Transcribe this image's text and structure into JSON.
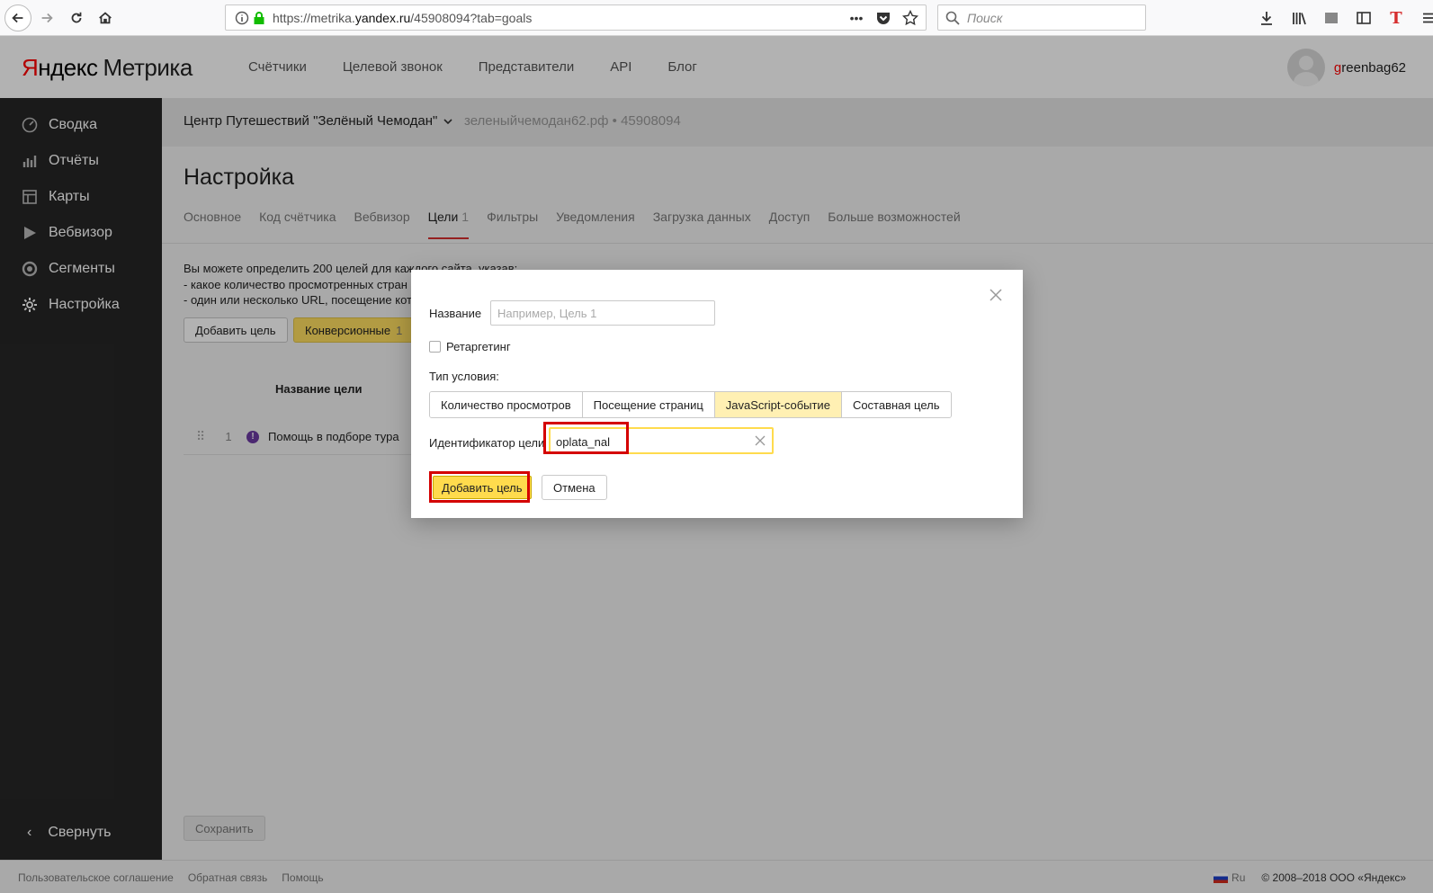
{
  "browser": {
    "url_prefix": "https://metrika.",
    "url_host": "yandex.ru",
    "url_rest": "/45908094?tab=goals",
    "search_placeholder": "Поиск",
    "more_label": "•••"
  },
  "header": {
    "logo_ya": "Я",
    "logo_ndex": "ндекс",
    "logo_product": "Метрика",
    "nav": [
      "Счётчики",
      "Целевой звонок",
      "Представители",
      "API",
      "Блог"
    ],
    "user_first": "g",
    "user_rest": "reenbag62"
  },
  "sidebar": {
    "items": [
      {
        "label": "Сводка",
        "icon": "gauge-icon"
      },
      {
        "label": "Отчёты",
        "icon": "bar-chart-icon"
      },
      {
        "label": "Карты",
        "icon": "map-grid-icon"
      },
      {
        "label": "Вебвизор",
        "icon": "play-icon"
      },
      {
        "label": "Сегменты",
        "icon": "pie-icon"
      },
      {
        "label": "Настройка",
        "icon": "gear-icon"
      }
    ],
    "collapse_label": "Свернуть",
    "collapse_glyph": "‹"
  },
  "counter": {
    "name": "Центр Путешествий \"Зелёный Чемодан\"",
    "meta": "зеленыйчемодан62.рф • 45908094"
  },
  "page": {
    "title": "Настройка",
    "tabs": [
      {
        "label": "Основное"
      },
      {
        "label": "Код счётчика"
      },
      {
        "label": "Вебвизор"
      },
      {
        "label": "Цели",
        "count": "1"
      },
      {
        "label": "Фильтры"
      },
      {
        "label": "Уведомления"
      },
      {
        "label": "Загрузка данных"
      },
      {
        "label": "Доступ"
      },
      {
        "label": "Больше возможностей"
      }
    ],
    "intro_line1": "Вы можете определить 200 целей для каждого сайта, указав:",
    "intro_line2": "-  какое количество просмотренных стран",
    "intro_line3": "-  один или несколько URL, посещение кот",
    "add_goal_label": "Добавить цель",
    "conversion_label": "Конверсионные",
    "conversion_count": "1",
    "goal_col_header": "Название цели",
    "goals": [
      {
        "num": "1",
        "name": "Помощь в подборе тура",
        "warn": "!"
      }
    ],
    "save_label": "Сохранить",
    "drag_glyph": "⠿"
  },
  "modal": {
    "name_label": "Название",
    "name_placeholder": "Например, Цель 1",
    "retargeting_label": "Ретаргетинг",
    "condition_label": "Тип условия:",
    "conditions": [
      {
        "label": "Количество просмотров",
        "active": false
      },
      {
        "label": "Посещение страниц",
        "active": false
      },
      {
        "label": "JavaScript-событие",
        "active": true
      },
      {
        "label": "Составная цель",
        "active": false
      }
    ],
    "id_label": "Идентификатор цели",
    "id_value": "oplata_nal",
    "add_label": "Добавить цель",
    "cancel_label": "Отмена"
  },
  "footer": {
    "links": [
      "Пользовательское соглашение",
      "Обратная связь",
      "Помощь"
    ],
    "lang": "Ru",
    "copyright": "© 2008–2018 ООО «Яндекс»"
  },
  "colors": {
    "accent_yellow": "#ffdb4d",
    "active_tab_underline": "#d62e2e",
    "highlight_red": "#d40000",
    "sidebar_bg": "#262626"
  }
}
